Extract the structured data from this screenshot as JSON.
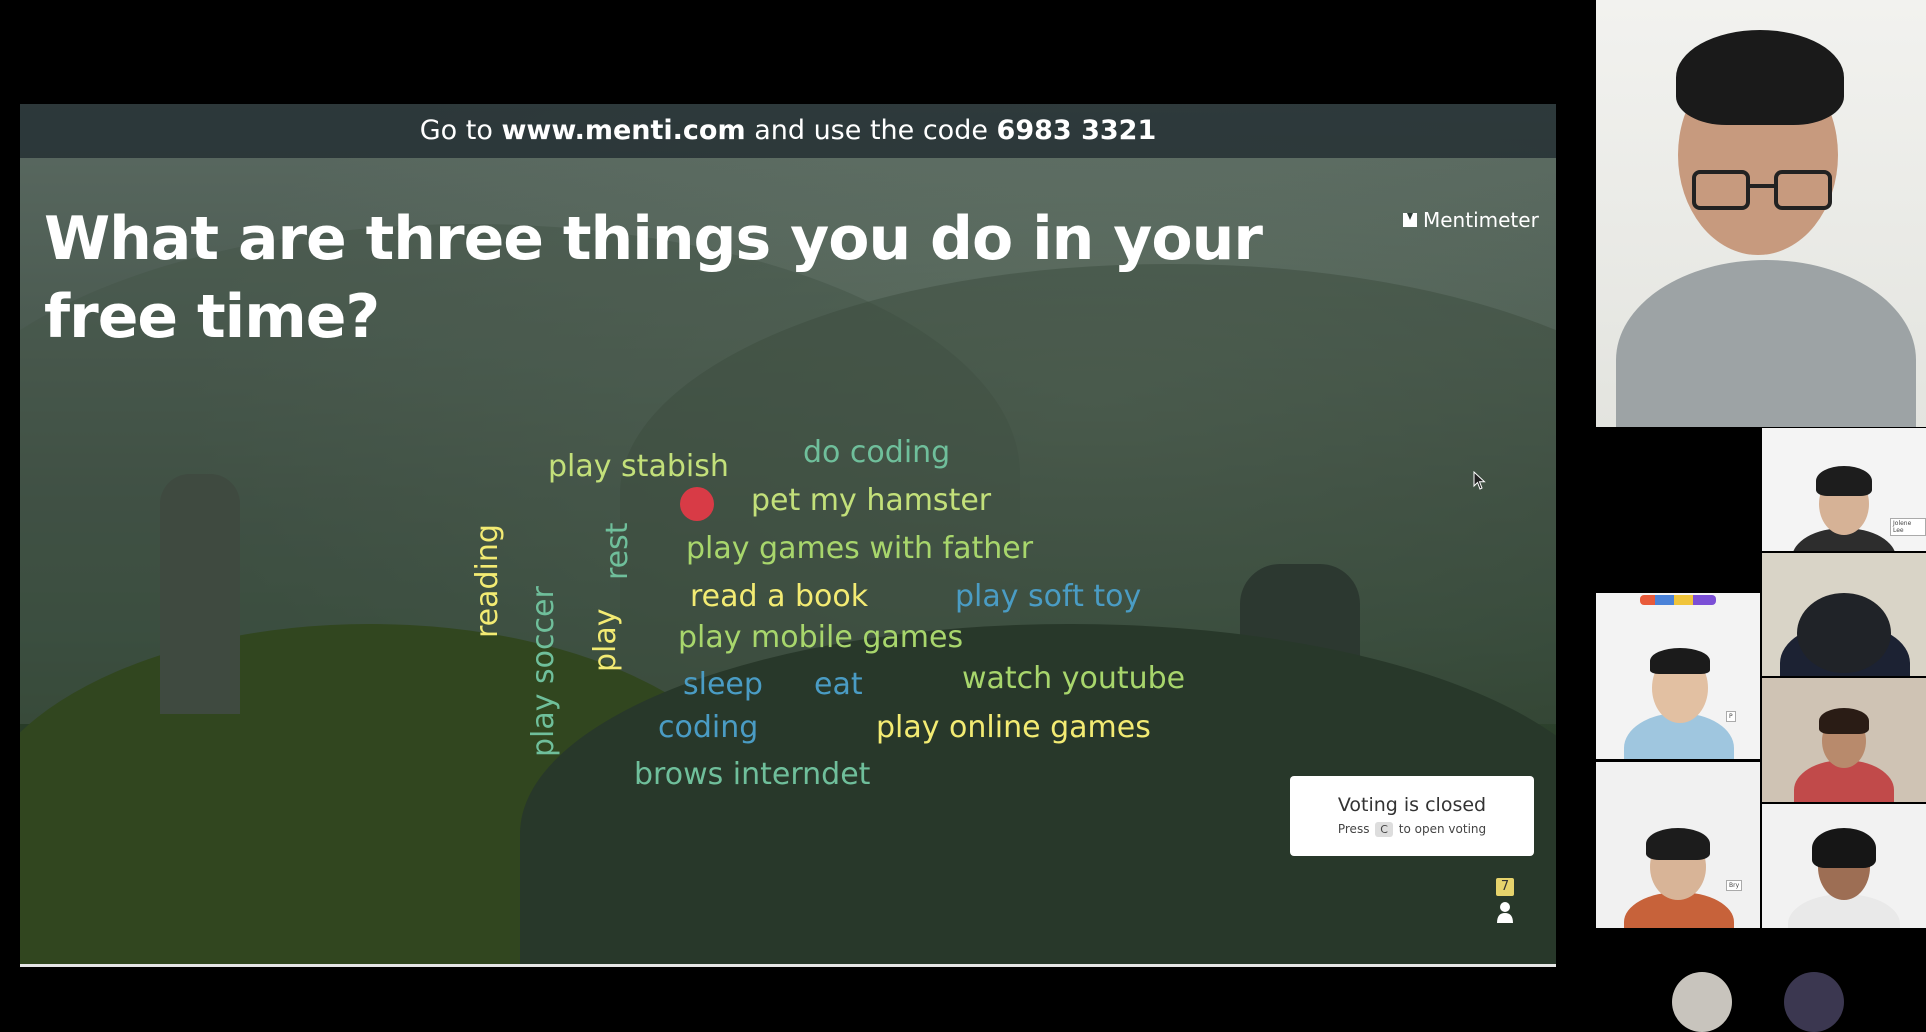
{
  "slide": {
    "banner": {
      "prefix": "Go to ",
      "url": "www.menti.com",
      "middle": " and use the code ",
      "code": "6983 3321"
    },
    "question": "What are three things you do in your free time?",
    "brand": "Mentimeter",
    "word_cloud": [
      {
        "text": "play stabish"
      },
      {
        "text": "do coding"
      },
      {
        "text": "pet my hamster"
      },
      {
        "text": "play games with father"
      },
      {
        "text": "reading"
      },
      {
        "text": "rest"
      },
      {
        "text": "play soccer"
      },
      {
        "text": "play"
      },
      {
        "text": "read a book"
      },
      {
        "text": "play soft toy"
      },
      {
        "text": "play mobile games"
      },
      {
        "text": "sleep"
      },
      {
        "text": "eat"
      },
      {
        "text": "watch youtube"
      },
      {
        "text": "coding"
      },
      {
        "text": "play online games"
      },
      {
        "text": "brows interndet"
      }
    ],
    "voting": {
      "status": "Voting is closed",
      "hint_pre": "Press",
      "key": "C",
      "hint_post": "to open voting"
    },
    "participant_count": "7"
  },
  "participants": {
    "labels": [
      "Jolene Lee",
      "P",
      "Bry"
    ]
  },
  "colors": {
    "yellow": "#f3eb73",
    "green": "#a8d66c",
    "teal": "#6fbf9b",
    "blue": "#4a9cc4",
    "vote_dot": "#d83b46"
  }
}
